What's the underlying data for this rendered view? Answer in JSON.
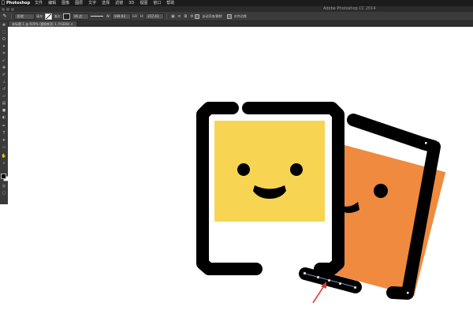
{
  "menubar": {
    "app_name": "Photoshop",
    "items": [
      "文件",
      "编辑",
      "图像",
      "图层",
      "文字",
      "选择",
      "滤镜",
      "3D",
      "视图",
      "窗口",
      "帮助"
    ]
  },
  "titlebar": {
    "app_title": "Adobe Photoshop CC 2014"
  },
  "options_bar": {
    "mode": "形状",
    "fill_label": "填充:",
    "stroke_label": "描边:",
    "stroke_width": "16 点",
    "width_label": "W:",
    "width_value": "169.03",
    "link_label": "GO",
    "height_label": "H:",
    "height_value": "217.41",
    "auto_add_delete": "自动添加/删除",
    "align_edges": "对齐边缘"
  },
  "document_tab": {
    "label": "未标题-1 @ 600% (圆角矩形 1, RGB/8) ×"
  },
  "tools": [
    "move-tool",
    "marquee-tool",
    "lasso-tool",
    "quick-select-tool",
    "crop-tool",
    "eyedropper-tool",
    "healing-brush-tool",
    "brush-tool",
    "clone-stamp-tool",
    "history-brush-tool",
    "eraser-tool",
    "gradient-tool",
    "blur-tool",
    "dodge-tool",
    "pen-tool",
    "type-tool",
    "path-select-tool",
    "shape-tool",
    "hand-tool",
    "zoom-tool"
  ],
  "colors": {
    "foreground": "#000000",
    "background": "#ffffff",
    "front_photo": "#f7d552",
    "back_photo": "#ef8a3e",
    "frame": "#000000",
    "annotation_arrow": "#d93a32"
  }
}
